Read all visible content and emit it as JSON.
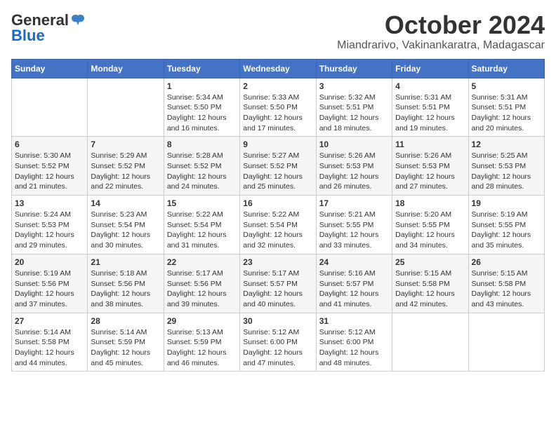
{
  "logo": {
    "general": "General",
    "blue": "Blue"
  },
  "title": "October 2024",
  "location": "Miandrarivo, Vakinankaratra, Madagascar",
  "weekdays": [
    "Sunday",
    "Monday",
    "Tuesday",
    "Wednesday",
    "Thursday",
    "Friday",
    "Saturday"
  ],
  "weeks": [
    [
      {
        "day": "",
        "sunrise": "",
        "sunset": "",
        "daylight": ""
      },
      {
        "day": "",
        "sunrise": "",
        "sunset": "",
        "daylight": ""
      },
      {
        "day": "1",
        "sunrise": "Sunrise: 5:34 AM",
        "sunset": "Sunset: 5:50 PM",
        "daylight": "Daylight: 12 hours and 16 minutes."
      },
      {
        "day": "2",
        "sunrise": "Sunrise: 5:33 AM",
        "sunset": "Sunset: 5:50 PM",
        "daylight": "Daylight: 12 hours and 17 minutes."
      },
      {
        "day": "3",
        "sunrise": "Sunrise: 5:32 AM",
        "sunset": "Sunset: 5:51 PM",
        "daylight": "Daylight: 12 hours and 18 minutes."
      },
      {
        "day": "4",
        "sunrise": "Sunrise: 5:31 AM",
        "sunset": "Sunset: 5:51 PM",
        "daylight": "Daylight: 12 hours and 19 minutes."
      },
      {
        "day": "5",
        "sunrise": "Sunrise: 5:31 AM",
        "sunset": "Sunset: 5:51 PM",
        "daylight": "Daylight: 12 hours and 20 minutes."
      }
    ],
    [
      {
        "day": "6",
        "sunrise": "Sunrise: 5:30 AM",
        "sunset": "Sunset: 5:52 PM",
        "daylight": "Daylight: 12 hours and 21 minutes."
      },
      {
        "day": "7",
        "sunrise": "Sunrise: 5:29 AM",
        "sunset": "Sunset: 5:52 PM",
        "daylight": "Daylight: 12 hours and 22 minutes."
      },
      {
        "day": "8",
        "sunrise": "Sunrise: 5:28 AM",
        "sunset": "Sunset: 5:52 PM",
        "daylight": "Daylight: 12 hours and 24 minutes."
      },
      {
        "day": "9",
        "sunrise": "Sunrise: 5:27 AM",
        "sunset": "Sunset: 5:52 PM",
        "daylight": "Daylight: 12 hours and 25 minutes."
      },
      {
        "day": "10",
        "sunrise": "Sunrise: 5:26 AM",
        "sunset": "Sunset: 5:53 PM",
        "daylight": "Daylight: 12 hours and 26 minutes."
      },
      {
        "day": "11",
        "sunrise": "Sunrise: 5:26 AM",
        "sunset": "Sunset: 5:53 PM",
        "daylight": "Daylight: 12 hours and 27 minutes."
      },
      {
        "day": "12",
        "sunrise": "Sunrise: 5:25 AM",
        "sunset": "Sunset: 5:53 PM",
        "daylight": "Daylight: 12 hours and 28 minutes."
      }
    ],
    [
      {
        "day": "13",
        "sunrise": "Sunrise: 5:24 AM",
        "sunset": "Sunset: 5:53 PM",
        "daylight": "Daylight: 12 hours and 29 minutes."
      },
      {
        "day": "14",
        "sunrise": "Sunrise: 5:23 AM",
        "sunset": "Sunset: 5:54 PM",
        "daylight": "Daylight: 12 hours and 30 minutes."
      },
      {
        "day": "15",
        "sunrise": "Sunrise: 5:22 AM",
        "sunset": "Sunset: 5:54 PM",
        "daylight": "Daylight: 12 hours and 31 minutes."
      },
      {
        "day": "16",
        "sunrise": "Sunrise: 5:22 AM",
        "sunset": "Sunset: 5:54 PM",
        "daylight": "Daylight: 12 hours and 32 minutes."
      },
      {
        "day": "17",
        "sunrise": "Sunrise: 5:21 AM",
        "sunset": "Sunset: 5:55 PM",
        "daylight": "Daylight: 12 hours and 33 minutes."
      },
      {
        "day": "18",
        "sunrise": "Sunrise: 5:20 AM",
        "sunset": "Sunset: 5:55 PM",
        "daylight": "Daylight: 12 hours and 34 minutes."
      },
      {
        "day": "19",
        "sunrise": "Sunrise: 5:19 AM",
        "sunset": "Sunset: 5:55 PM",
        "daylight": "Daylight: 12 hours and 35 minutes."
      }
    ],
    [
      {
        "day": "20",
        "sunrise": "Sunrise: 5:19 AM",
        "sunset": "Sunset: 5:56 PM",
        "daylight": "Daylight: 12 hours and 37 minutes."
      },
      {
        "day": "21",
        "sunrise": "Sunrise: 5:18 AM",
        "sunset": "Sunset: 5:56 PM",
        "daylight": "Daylight: 12 hours and 38 minutes."
      },
      {
        "day": "22",
        "sunrise": "Sunrise: 5:17 AM",
        "sunset": "Sunset: 5:56 PM",
        "daylight": "Daylight: 12 hours and 39 minutes."
      },
      {
        "day": "23",
        "sunrise": "Sunrise: 5:17 AM",
        "sunset": "Sunset: 5:57 PM",
        "daylight": "Daylight: 12 hours and 40 minutes."
      },
      {
        "day": "24",
        "sunrise": "Sunrise: 5:16 AM",
        "sunset": "Sunset: 5:57 PM",
        "daylight": "Daylight: 12 hours and 41 minutes."
      },
      {
        "day": "25",
        "sunrise": "Sunrise: 5:15 AM",
        "sunset": "Sunset: 5:58 PM",
        "daylight": "Daylight: 12 hours and 42 minutes."
      },
      {
        "day": "26",
        "sunrise": "Sunrise: 5:15 AM",
        "sunset": "Sunset: 5:58 PM",
        "daylight": "Daylight: 12 hours and 43 minutes."
      }
    ],
    [
      {
        "day": "27",
        "sunrise": "Sunrise: 5:14 AM",
        "sunset": "Sunset: 5:58 PM",
        "daylight": "Daylight: 12 hours and 44 minutes."
      },
      {
        "day": "28",
        "sunrise": "Sunrise: 5:14 AM",
        "sunset": "Sunset: 5:59 PM",
        "daylight": "Daylight: 12 hours and 45 minutes."
      },
      {
        "day": "29",
        "sunrise": "Sunrise: 5:13 AM",
        "sunset": "Sunset: 5:59 PM",
        "daylight": "Daylight: 12 hours and 46 minutes."
      },
      {
        "day": "30",
        "sunrise": "Sunrise: 5:12 AM",
        "sunset": "Sunset: 6:00 PM",
        "daylight": "Daylight: 12 hours and 47 minutes."
      },
      {
        "day": "31",
        "sunrise": "Sunrise: 5:12 AM",
        "sunset": "Sunset: 6:00 PM",
        "daylight": "Daylight: 12 hours and 48 minutes."
      },
      {
        "day": "",
        "sunrise": "",
        "sunset": "",
        "daylight": ""
      },
      {
        "day": "",
        "sunrise": "",
        "sunset": "",
        "daylight": ""
      }
    ]
  ]
}
